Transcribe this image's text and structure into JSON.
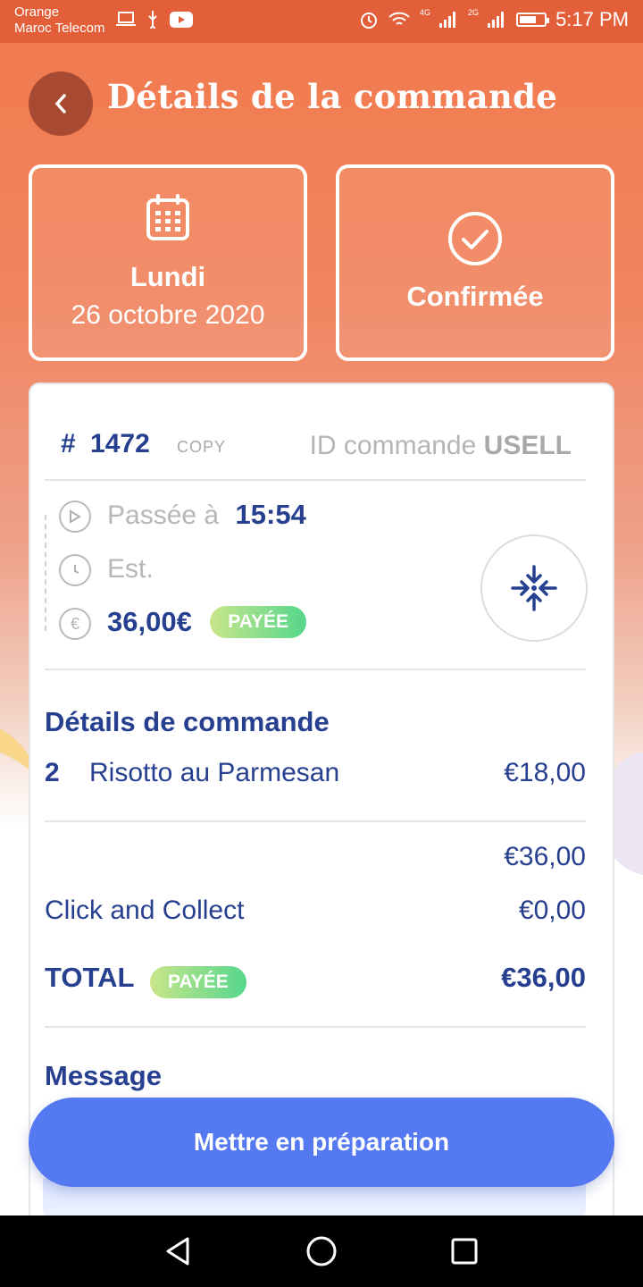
{
  "status_bar": {
    "carrier_line1": "Orange",
    "carrier_line2": "Maroc Telecom",
    "network_1": "4G",
    "network_2": "2G",
    "time": "5:17 PM"
  },
  "header": {
    "title": "Détails de la commande",
    "back_icon": "chevron-left-icon"
  },
  "date_tile": {
    "icon": "calendar-icon",
    "day": "Lundi",
    "date": "26 octobre 2020"
  },
  "status_tile": {
    "icon": "check-circle-icon",
    "status": "Confirmée"
  },
  "order": {
    "hash": "#",
    "number": "1472",
    "copy_label": "COPY",
    "id_label": "ID commande",
    "id_value": "USELL",
    "placed_label": "Passée à",
    "placed_time": "15:54",
    "est_label": "Est.",
    "amount": "36,00€",
    "payment_badge": "PAYÉE"
  },
  "details": {
    "title": "Détails de commande",
    "items": [
      {
        "qty": "2",
        "name": "Risotto au Parmesan",
        "price": "€18,00"
      }
    ],
    "subtotal": "€36,00",
    "fee_label": "Click and Collect",
    "fee_value": "€0,00",
    "total_label": "TOTAL",
    "total_badge": "PAYÉE",
    "total_value": "€36,00"
  },
  "message": {
    "title": "Message"
  },
  "action": {
    "label": "Mettre en préparation"
  },
  "colors": {
    "accent_orange": "#f3794c",
    "brand_blue": "#273f8f",
    "button_blue": "#5479f0",
    "paid_green": "#55d78c"
  }
}
